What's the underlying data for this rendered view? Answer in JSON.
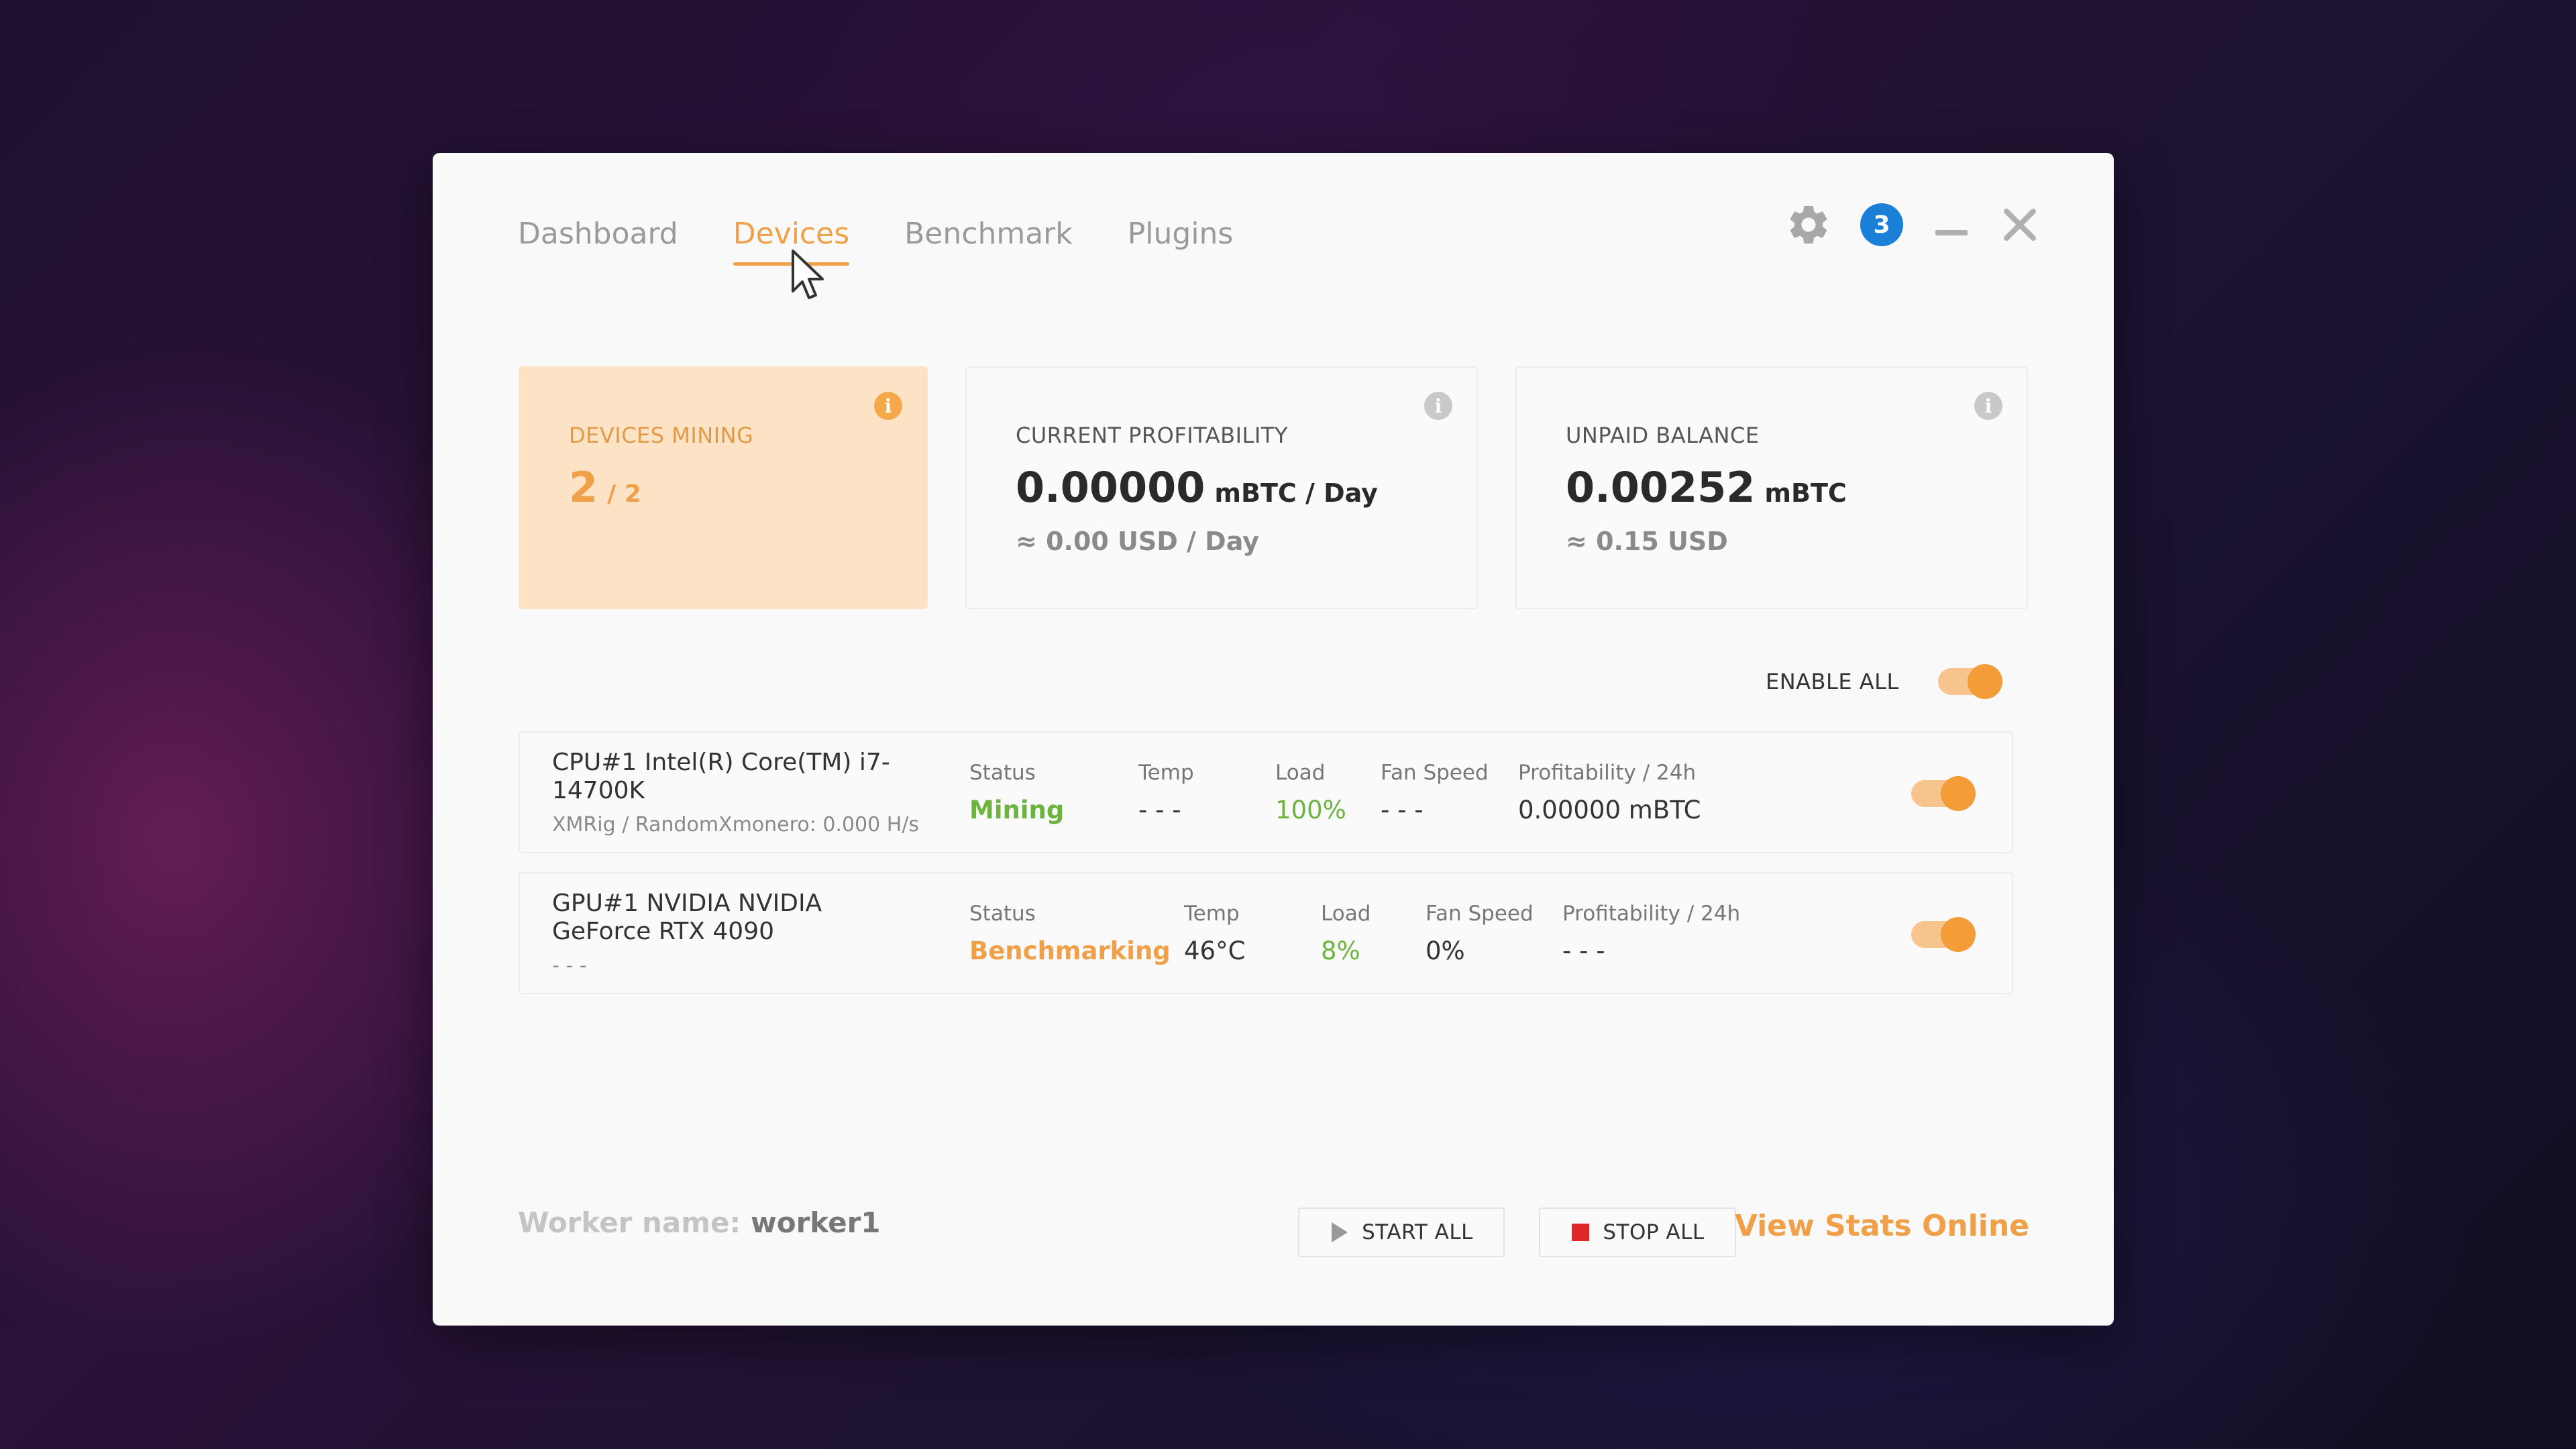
{
  "tabs": [
    {
      "label": "Dashboard",
      "active": false
    },
    {
      "label": "Devices",
      "active": true
    },
    {
      "label": "Benchmark",
      "active": false
    },
    {
      "label": "Plugins",
      "active": false
    }
  ],
  "header": {
    "notification_count": "3",
    "icons": [
      "gear-icon",
      "notification-badge",
      "minimize-icon",
      "close-icon"
    ]
  },
  "cards": {
    "devices_mining": {
      "label": "DEVICES MINING",
      "value": "2",
      "unit": "/ 2"
    },
    "current_profitability": {
      "label": "CURRENT PROFITABILITY",
      "value": "0.00000",
      "unit": "mBTC / Day",
      "sub": "≈ 0.00 USD / Day"
    },
    "unpaid_balance": {
      "label": "UNPAID BALANCE",
      "value": "0.00252",
      "unit": "mBTC",
      "sub": "≈ 0.15 USD"
    },
    "info_glyph": "i"
  },
  "enable_all": {
    "label": "ENABLE ALL",
    "on": true
  },
  "devices": [
    {
      "name": "CPU#1 Intel(R) Core(TM) i7-14700K",
      "algo": "XMRig / RandomXmonero: 0.000 H/s",
      "status_label": "Status",
      "status": "Mining",
      "temp_label": "Temp",
      "temp": "- - -",
      "load_label": "Load",
      "load": "100%",
      "fan_label": "Fan Speed",
      "fan": "- - -",
      "profit_label": "Profitability / 24h",
      "profit": "0.00000 mBTC",
      "enabled": true
    },
    {
      "name": "GPU#1 NVIDIA NVIDIA GeForce RTX 4090",
      "algo": "- - -",
      "status_label": "Status",
      "status": "Benchmarking",
      "temp_label": "Temp",
      "temp": "46°C",
      "load_label": "Load",
      "load": "8%",
      "fan_label": "Fan Speed",
      "fan": "0%",
      "profit_label": "Profitability / 24h",
      "profit": "- - -",
      "enabled": true
    }
  ],
  "footer": {
    "worker_label": "Worker name:",
    "worker_name": "worker1",
    "start_all": "START ALL",
    "stop_all": "STOP ALL",
    "view_stats": "View Stats Online"
  },
  "colors": {
    "accent": "#f0a048",
    "toggle_knob": "#f39c38",
    "badge": "#1a7fd6",
    "green": "#6cb33f",
    "stop_red": "#e02828"
  }
}
